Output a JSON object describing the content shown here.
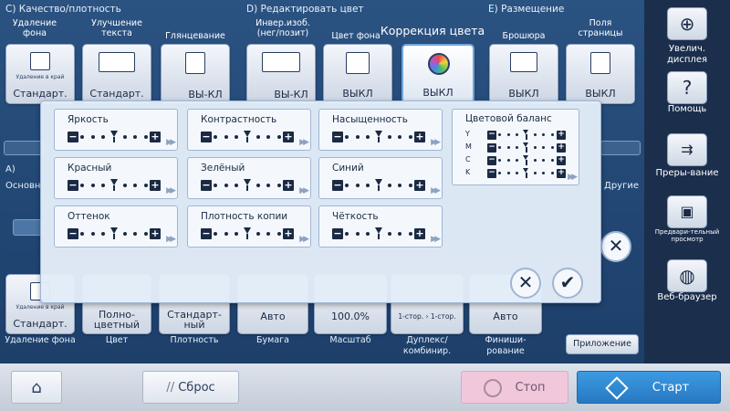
{
  "header": {
    "sectionC": "C)   Качество/плотность",
    "sectionD": "D)   Редактировать цвет",
    "sectionE": "E)   Размещение"
  },
  "columns": {
    "bg_removal": "Удаление фона",
    "text_enh": "Улучшение текста",
    "gloss": "Глянцевание",
    "invert": "Инвер.изоб. (нег/позит)",
    "color_bg": "Цвет фона",
    "color_corr": "Коррекция цвета",
    "booklet": "Брошюра",
    "page_margin": "Поля страницы"
  },
  "tiles": {
    "bg_removal_value": "Стандарт.",
    "bg_removal_icon_text": "Удаление в край",
    "text_enh_value": "Стандарт.",
    "gloss_value": "ВЫ-КЛ",
    "invert_value": "ВЫ-КЛ",
    "color_bg_value": "ВЫКЛ",
    "color_corr_value": "ВЫКЛ",
    "booklet_value": "ВЫКЛ",
    "page_margin_value": "ВЫКЛ"
  },
  "side": {
    "a_label": "A)",
    "basic": "Основн",
    "other": "Другие"
  },
  "bottom_tiles": {
    "bg_removal_icon_text": "Удаление в край",
    "bg_removal_value": "Стандарт.",
    "color_value": "Полно-цветный",
    "density_value": "Стандарт-ный",
    "paper_value": "Авто",
    "scale_value": "100.0%",
    "duplex_value": "1-стор. › 1-стор.",
    "finishing_value": "Авто"
  },
  "bottom_labels": {
    "bg_removal": "Удаление фона",
    "color": "Цвет",
    "density": "Плотность",
    "paper": "Бумага",
    "scale": "Масштаб",
    "duplex": "Дуплекс/ комбинир.",
    "finishing": "Финиши-рование"
  },
  "overlay": {
    "title": "Коррекция цвета",
    "adjustments": [
      {
        "label": "Яркость",
        "position": 3
      },
      {
        "label": "Контрастность",
        "position": 3
      },
      {
        "label": "Насыщенность",
        "position": 3
      },
      {
        "label": "Красный",
        "position": 3
      },
      {
        "label": "Зелёный",
        "position": 3
      },
      {
        "label": "Синий",
        "position": 3
      },
      {
        "label": "Оттенок",
        "position": 3
      },
      {
        "label": "Плотность копии",
        "position": 3
      },
      {
        "label": "Чёткость",
        "position": 3
      }
    ],
    "color_balance": {
      "title": "Цветовой баланс",
      "rows": [
        {
          "label": "Y",
          "position": 3
        },
        {
          "label": "M",
          "position": 3
        },
        {
          "label": "C",
          "position": 3
        },
        {
          "label": "K",
          "position": 3
        }
      ]
    },
    "cancel_glyph": "✕",
    "ok_glyph": "✔",
    "close_glyph": "✕"
  },
  "right_panel": {
    "zoom": "Увелич. дисплея",
    "help": "Помощь",
    "interrupt": "Преры-вание",
    "preview": "Предвари-тельный просмотр",
    "browser": "Веб-браузер"
  },
  "bottom_bar": {
    "reset": "Сброс",
    "stop": "Стоп",
    "start": "Старт"
  },
  "app_button": "Приложение",
  "colors": {
    "start": "#2f8fd8",
    "stop": "#f1c7dc",
    "panel_bg": "#244a78"
  }
}
